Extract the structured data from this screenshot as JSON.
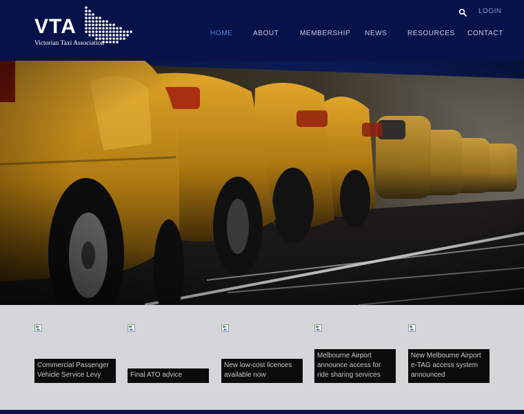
{
  "header": {
    "logo_text": "VTA",
    "logo_subtitle": "Victorian Taxi Association",
    "login_label": "LOGIN",
    "search_icon": "search-icon"
  },
  "nav": {
    "items": [
      {
        "label": "HOME",
        "active": true
      },
      {
        "label": "ABOUT",
        "active": false
      },
      {
        "label": "MEMBERSHIP",
        "active": false
      },
      {
        "label": "NEWS",
        "active": false
      },
      {
        "label": "RESOURCES",
        "active": false
      },
      {
        "label": "CONTACT",
        "active": false
      }
    ]
  },
  "hero": {
    "image": "taxi-rank-photo"
  },
  "news_tiles": [
    {
      "caption": "Commercial Passenger Vehicle Service Levy"
    },
    {
      "caption": "Final ATO advice"
    },
    {
      "caption": "New low-cost licences available now"
    },
    {
      "caption": "Melbourne Airport announce access for ride sharing services"
    },
    {
      "caption": "New Melbourne Airport e-TAG access system announced"
    }
  ],
  "colors": {
    "header_bg": "#07124a",
    "nav_active": "#4f87d8",
    "tiles_bg": "#d5d6d8",
    "caption_bg": "#0b0b0c"
  }
}
